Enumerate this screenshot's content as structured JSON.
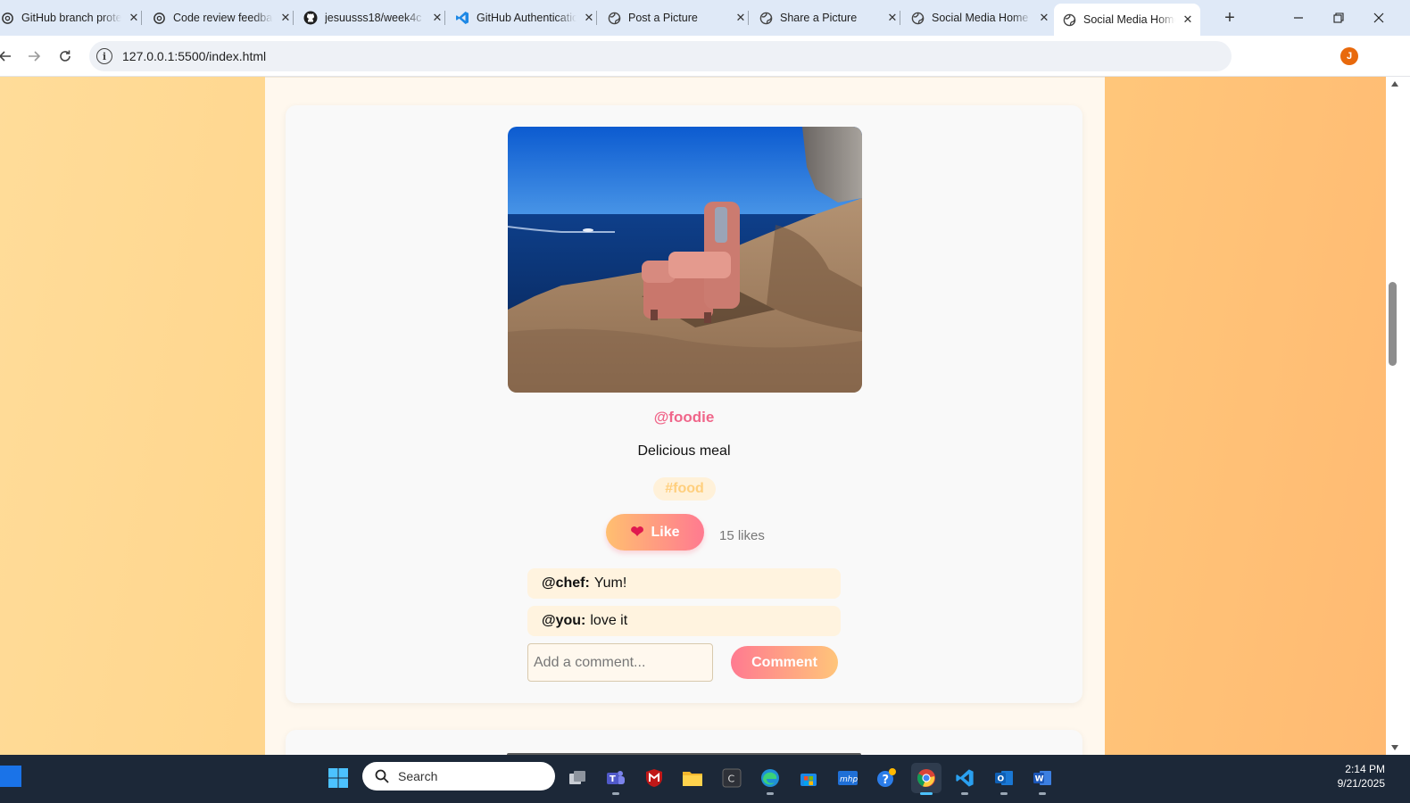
{
  "browser": {
    "tabs": [
      {
        "title": "GitHub branch protection",
        "icon": "openai-icon"
      },
      {
        "title": "Code review feedback",
        "icon": "openai-icon"
      },
      {
        "title": "jesuusss18/week4c",
        "icon": "github-icon"
      },
      {
        "title": "GitHub Authentication",
        "icon": "vscode-icon"
      },
      {
        "title": "Post a Picture",
        "icon": "globe-icon"
      },
      {
        "title": "Share a Picture",
        "icon": "globe-icon"
      },
      {
        "title": "Social Media Home",
        "icon": "globe-icon"
      },
      {
        "title": "Social Media Home",
        "icon": "globe-icon",
        "active": true
      }
    ],
    "url": "127.0.0.1:5500/index.html",
    "profile_initial": "J"
  },
  "post": {
    "username": "@foodie",
    "caption": "Delicious meal",
    "hashtag": "#food",
    "like_label": "Like",
    "likes_text": "15 likes",
    "comments": [
      {
        "user": "@chef:",
        "text": "Yum!"
      },
      {
        "user": "@you:",
        "text": "love it"
      }
    ],
    "comment_placeholder": "Add a comment...",
    "comment_button": "Comment"
  },
  "taskbar": {
    "search_label": "Search",
    "time": "2:14 PM",
    "date": "9/21/2025"
  },
  "colors": {
    "accent_pink": "#f0668a",
    "accent_orange": "#ffbf70",
    "page_bg": "#ffcf80"
  }
}
